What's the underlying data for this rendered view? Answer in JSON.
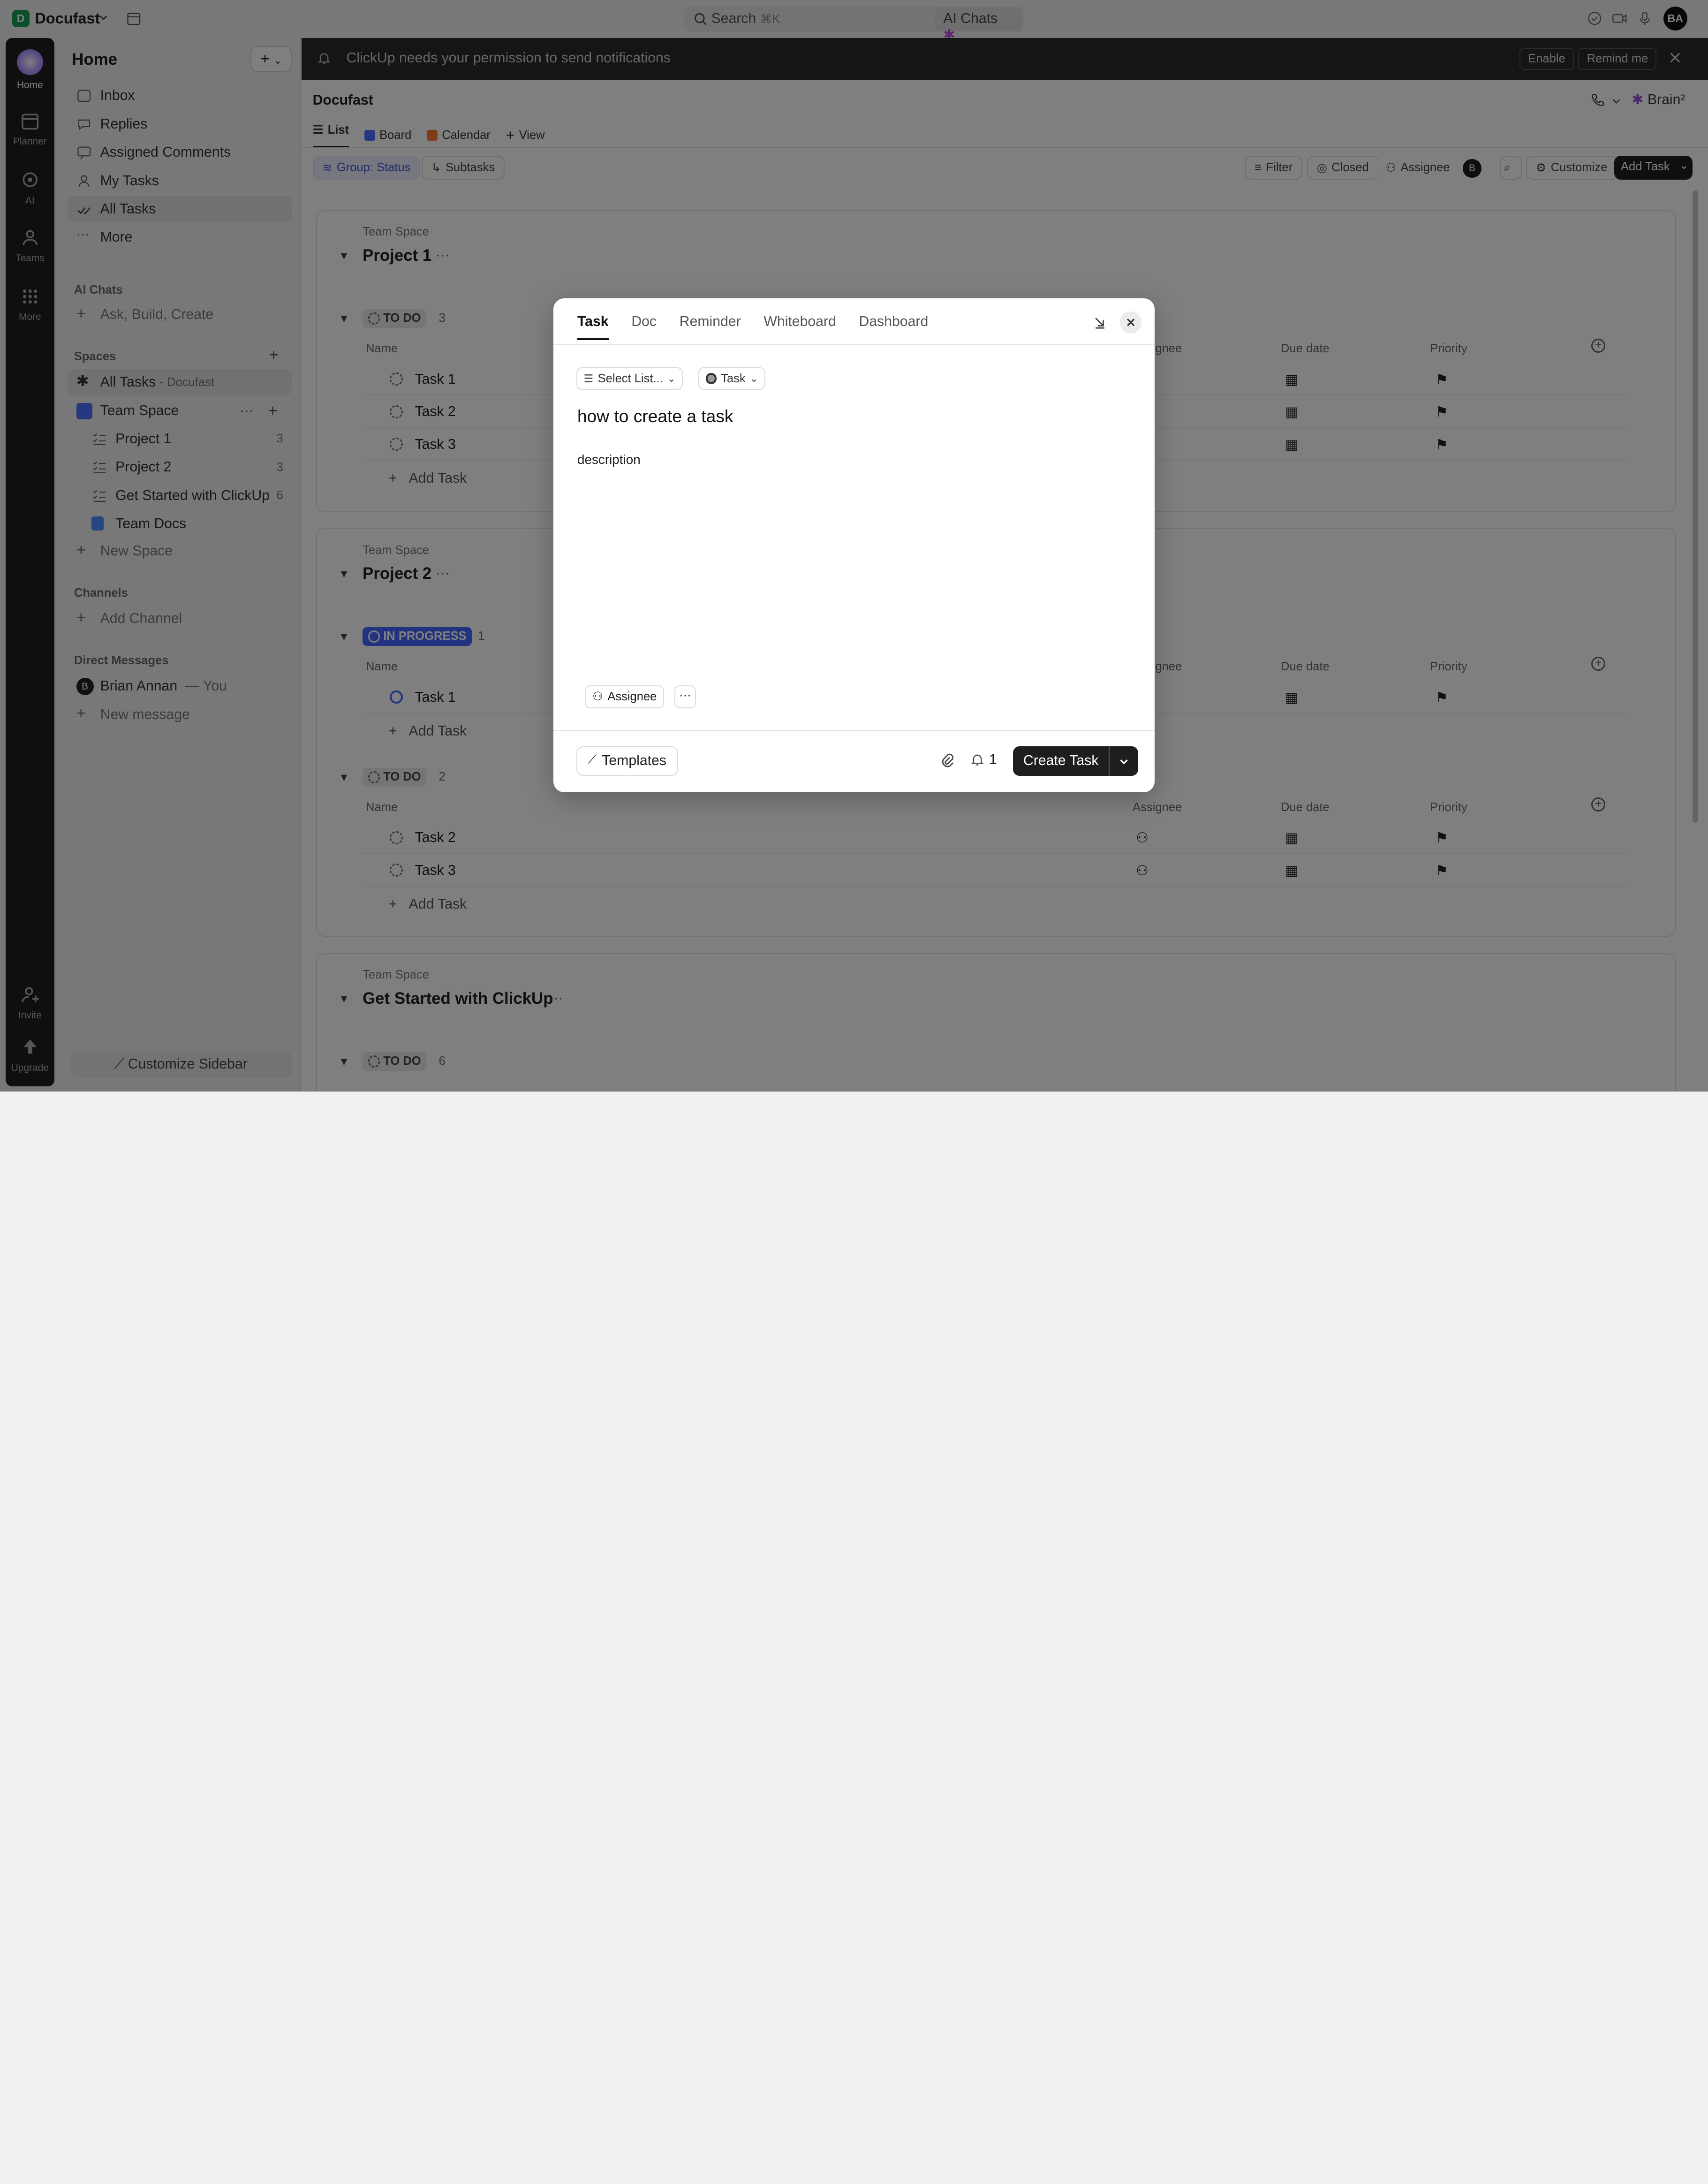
{
  "topbar": {
    "workspace_initial": "D",
    "workspace_name": "Docufast",
    "search_label": "Search",
    "search_shortcut": "⌘K",
    "ai_chats": "AI Chats",
    "avatar": "BA"
  },
  "rail": {
    "home": "Home",
    "planner": "Planner",
    "ai": "AI",
    "teams": "Teams",
    "more": "More",
    "invite": "Invite",
    "upgrade": "Upgrade"
  },
  "sidebar": {
    "title": "Home",
    "inbox": "Inbox",
    "replies": "Replies",
    "assigned_comments": "Assigned Comments",
    "my_tasks": "My Tasks",
    "all_tasks": "All Tasks",
    "more": "More",
    "ai_chats_head": "AI Chats",
    "ask_build": "Ask, Build, Create",
    "spaces_head": "Spaces",
    "all_tasks_space": "All Tasks",
    "all_tasks_suffix": "- Docufast",
    "team_space": "Team Space",
    "project1": "Project 1",
    "project1_count": "3",
    "project2": "Project 2",
    "project2_count": "3",
    "get_started": "Get Started with ClickUp",
    "get_started_count": "6",
    "team_docs": "Team Docs",
    "new_space": "New Space",
    "channels_head": "Channels",
    "add_channel": "Add Channel",
    "dm_head": "Direct Messages",
    "dm_user": "Brian Annan",
    "dm_you": "— You",
    "dm_initial": "B",
    "new_message": "New message",
    "customize": "Customize Sidebar"
  },
  "notif": {
    "text": "ClickUp needs your permission to send notifications",
    "enable": "Enable",
    "remind": "Remind me"
  },
  "main": {
    "crumb": "Docufast",
    "brain": "Brain²",
    "views": {
      "list": "List",
      "board": "Board",
      "calendar": "Calendar",
      "view": "View"
    },
    "toolbar": {
      "group": "Group: Status",
      "subtasks": "Subtasks",
      "filter": "Filter",
      "closed": "Closed",
      "assignee": "Assignee",
      "assignee_initial": "B",
      "customize": "Customize",
      "add_task": "Add Task"
    },
    "columns": {
      "name": "Name",
      "assignee": "Assignee",
      "due": "Due date",
      "priority": "Priority"
    },
    "g1": {
      "space": "Team Space",
      "title": "Project 1",
      "status": "TO DO",
      "count": "3",
      "tasks": [
        "Task 1",
        "Task 2",
        "Task 3"
      ],
      "add": "Add Task"
    },
    "g2": {
      "space": "Team Space",
      "title": "Project 2",
      "status": "IN PROGRESS",
      "count": "1",
      "tasks": [
        "Task 1"
      ],
      "add": "Add Task",
      "status2": "TO DO",
      "count2": "2",
      "tasks2": [
        "Task 2",
        "Task 3"
      ],
      "add2": "Add Task"
    },
    "g3": {
      "space": "Team Space",
      "title": "Get Started with ClickUp",
      "status": "TO DO",
      "count": "6"
    }
  },
  "modal": {
    "tabs": [
      "Task",
      "Doc",
      "Reminder",
      "Whiteboard",
      "Dashboard"
    ],
    "select_list": "Select List...",
    "task_type": "Task",
    "title": "how to create a task",
    "description": "description",
    "assignee": "Assignee",
    "more": "···",
    "templates": "Templates",
    "notify_count": "1",
    "create": "Create Task"
  }
}
